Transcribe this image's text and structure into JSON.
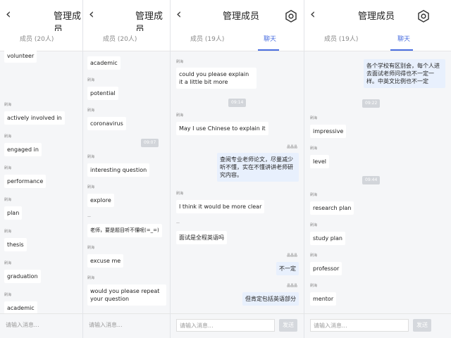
{
  "panel1": {
    "back": "‹",
    "title": "管理成员",
    "tab_members": "成员 (20人)",
    "input_placeholder": "请输入消息...",
    "items": [
      {
        "name": "",
        "text": "volunteer"
      },
      {
        "name": "刷海",
        "text": "actively involved in"
      },
      {
        "name": "刷海",
        "text": "engaged in"
      },
      {
        "name": "刷海",
        "text": "performance"
      },
      {
        "name": "刷海",
        "text": "plan"
      },
      {
        "name": "刷海",
        "text": "thesis"
      },
      {
        "name": "刷海",
        "text": "graduation"
      },
      {
        "name": "刷海",
        "text": "academic"
      }
    ]
  },
  "panel2": {
    "back": "‹",
    "title": "管理成员",
    "tab_members": "成员 (20人)",
    "input_placeholder": "请输入消息...",
    "timestamp": "09:07",
    "items": [
      {
        "name": "",
        "text": "academic"
      },
      {
        "name": "刷海",
        "text": "potential"
      },
      {
        "name": "刷海",
        "text": "coronavirus"
      },
      {
        "name": "刷海",
        "text": "interesting question"
      },
      {
        "name": "刷海",
        "text": "explore"
      },
      {
        "name": "—",
        "text": "老师，要是题目听不懂呢(=_=)"
      },
      {
        "name": "刷海",
        "text": "excuse me"
      },
      {
        "name": "刷海",
        "text": "would you please repeat your question"
      }
    ]
  },
  "panel3": {
    "back": "‹",
    "title": "管理成员",
    "tab_members": "成员 (19人)",
    "tab_chat": "聊天",
    "input_placeholder": "请输入消息...",
    "send": "发送",
    "timestamp": "09:14",
    "items": [
      {
        "name": "刷海",
        "text": "could you please explain it a little bit more"
      },
      {
        "name": "刷海",
        "text": "May I use Chinese to explain it"
      },
      {
        "name": "晶晶晶",
        "text": "查阅专业老师论文，尽量减少听不懂，实在不懂讲讲老师研究内容。"
      },
      {
        "name": "刷海",
        "text": "I think it would be more clear"
      },
      {
        "name": "—",
        "text": "面试是全程英语吗"
      },
      {
        "name": "晶晶晶",
        "text": "不一定"
      },
      {
        "name": "晶晶晶",
        "text": "但肯定包括英语部分"
      }
    ]
  },
  "panel4": {
    "back": "‹",
    "title": "管理成员",
    "tab_members": "成员 (19人)",
    "tab_chat": "聊天",
    "input_placeholder": "请输入消息...",
    "send": "发送",
    "timestamp1": "09:22",
    "timestamp2": "09:44",
    "top_message": "各个学校有区别会，每个人进去面试老师问得也不一定一样。中英文比例也不一定",
    "items": [
      {
        "name": "刷海",
        "text": "impressive"
      },
      {
        "name": "刷海",
        "text": "level"
      },
      {
        "name": "刷海",
        "text": "research plan"
      },
      {
        "name": "刷海",
        "text": "study plan"
      },
      {
        "name": "刷海",
        "text": "professor"
      },
      {
        "name": "刷海",
        "text": "mentor"
      }
    ]
  },
  "colors": {
    "accent": "#4a6ee0",
    "mine_bubble": "#e8f0fd",
    "background": "#f5f6f8"
  }
}
